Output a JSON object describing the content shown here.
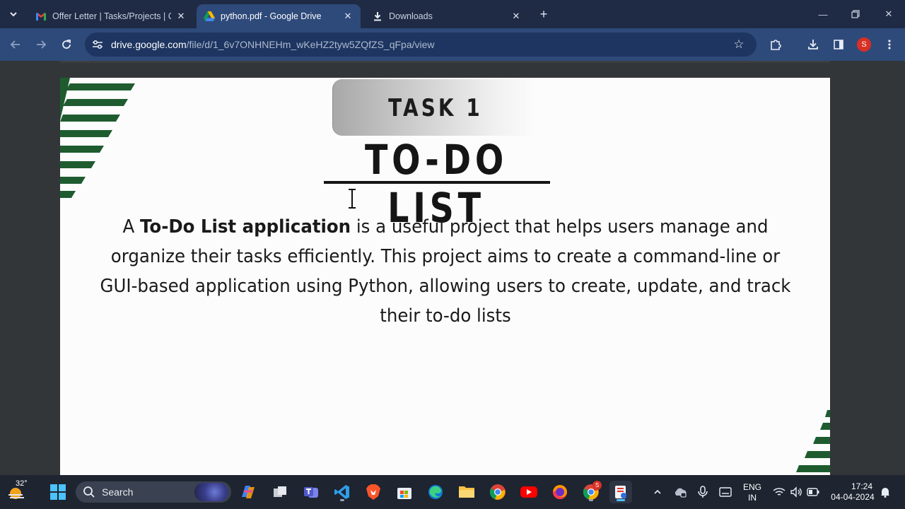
{
  "browser": {
    "tabs": [
      {
        "title": "Offer Letter | Tasks/Projects | Co",
        "favicon": "gmail-icon",
        "active": false
      },
      {
        "title": "python.pdf - Google Drive",
        "favicon": "google-drive-icon",
        "active": true
      },
      {
        "title": "Downloads",
        "favicon": "download-icon",
        "active": false
      }
    ],
    "url_host": "drive.google.com",
    "url_path": "/file/d/1_6v7ONHNEHm_wKeHZ2tyw5ZQfZS_qFpa/view",
    "profile_initial": "S",
    "colors": {
      "titlebar": "#1f2b44",
      "toolbar": "#2e4a7a",
      "omnibox": "#1d3560",
      "profile": "#d93025"
    }
  },
  "document": {
    "badge": "TASK 1",
    "heading": "TO-DO LIST",
    "body_lead": "A ",
    "body_bold": "To-Do List application",
    "body_rest": " is a useful project that helps users manage and organize their tasks efficiently. This project aims to create a command-line or GUI-based application using Python, allowing users to create, update, and track their to-do lists",
    "accent_color": "#1e5c30"
  },
  "taskbar": {
    "weather_temp": "32°",
    "search_label": "Search",
    "language_top": "ENG",
    "language_bottom": "IN",
    "time": "17:24",
    "date": "04-04-2024",
    "chrome_badge": "S"
  }
}
